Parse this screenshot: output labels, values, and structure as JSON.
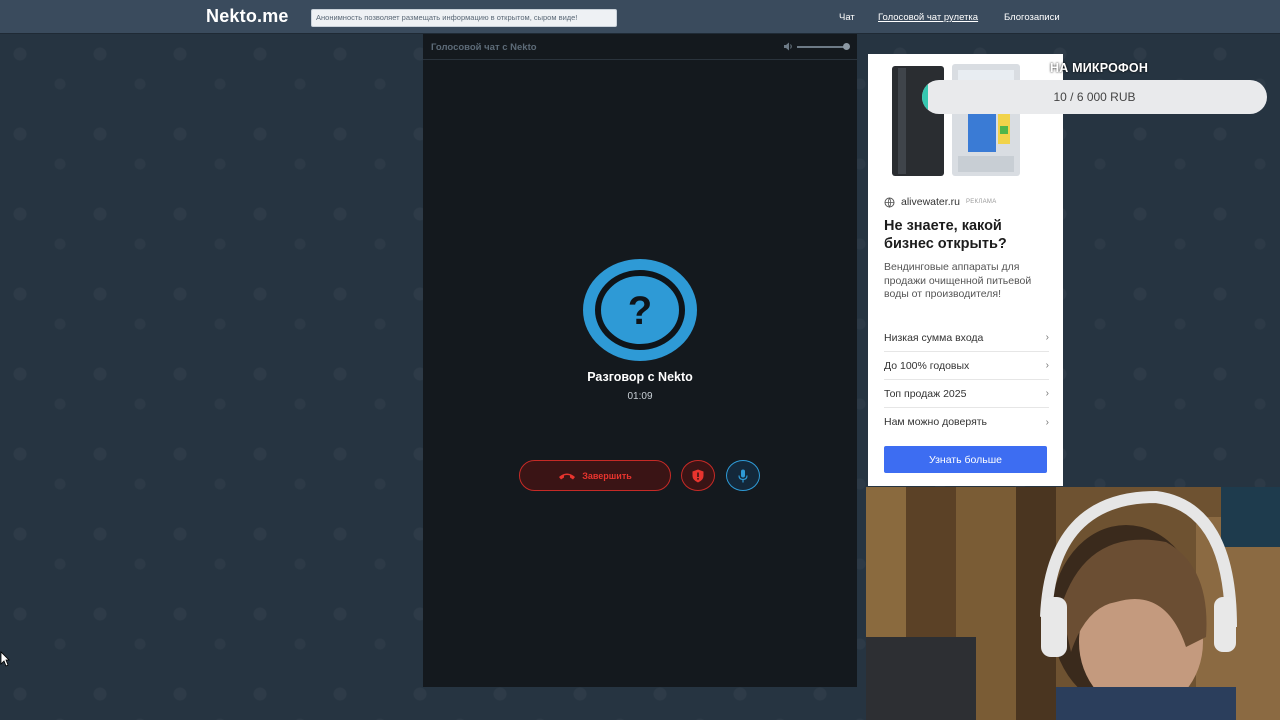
{
  "header": {
    "logo": "Nekto.me",
    "notice": "Анонимность позволяет размещать информацию в открытом, сыром виде!",
    "nav": [
      {
        "label": "Чат",
        "active": false
      },
      {
        "label": "Голосовой чат рулетка",
        "active": true
      },
      {
        "label": "Блогозаписи",
        "active": false
      }
    ]
  },
  "chat": {
    "title": "Голосовой чат с Nekto",
    "volume_level": 0.9,
    "peer_name": "Разговор с Nekto",
    "timer": "01:09",
    "end_label": "Завершить",
    "icons": {
      "end": "hangup-icon",
      "report": "shield-icon",
      "mic": "microphone-icon",
      "avatar": "question-mark-icon",
      "volume": "speaker-icon"
    },
    "colors": {
      "end": "#e8342e",
      "mic": "#2e9ad6",
      "avatar": "#2e9ad6"
    }
  },
  "ad": {
    "domain": "alivewater.ru",
    "label": "РЕКЛАМА",
    "headline": "Не знаете, какой бизнес открыть?",
    "body": "Вендинговые аппараты для продажи очищенной питьевой воды от производителя!",
    "links": [
      "Низкая сумма входа",
      "До 100% годовых",
      "Топ продаж 2025",
      "Нам можно доверять"
    ],
    "cta": "Узнать больше",
    "cta_color": "#3d6df2"
  },
  "donation": {
    "title": "НА МИКРОФОН",
    "progress_text": "10 / 6 000 RUB",
    "progress_fraction": 0.0017,
    "fill_color": "#35c7b0"
  }
}
